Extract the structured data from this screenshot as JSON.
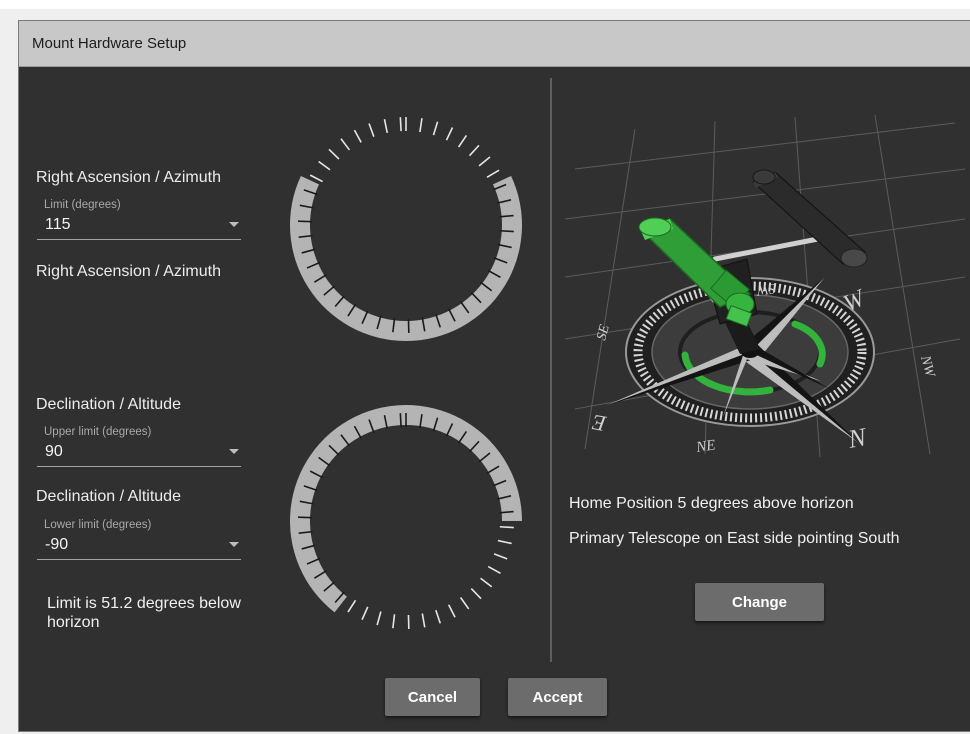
{
  "dialog": {
    "title": "Mount Hardware Setup"
  },
  "ra": {
    "section_label": "Right Ascension / Azimuth",
    "limit_field_label": "Limit (degrees)",
    "limit_value": "115",
    "secondary_label": "Right Ascension / Azimuth",
    "limit_fraction": 0.639
  },
  "dec": {
    "upper_section_label": "Declination / Altitude",
    "upper_field_label": "Upper limit (degrees)",
    "upper_value": "90",
    "lower_section_label": "Declination / Altitude",
    "lower_field_label": "Lower limit (degrees)",
    "lower_value": "-90",
    "limit_note": "Limit is 51.2 degrees below horizon"
  },
  "home": {
    "position_text": "Home Position 5 degrees above horizon",
    "telescope_text": "Primary Telescope on East side pointing South",
    "change_label": "Change"
  },
  "compass": {
    "labels": [
      "W",
      "SW",
      "S",
      "SE",
      "E",
      "NE",
      "N",
      "NW"
    ]
  },
  "buttons": {
    "cancel_label": "Cancel",
    "accept_label": "Accept"
  },
  "colors": {
    "accent_green": "#33b33d",
    "dial_fill": "#b4b4b4",
    "panel_bg": "#303030"
  }
}
